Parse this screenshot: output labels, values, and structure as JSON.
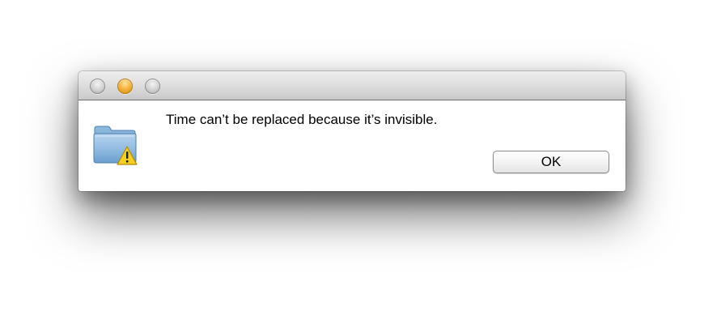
{
  "dialog": {
    "message": "Time can’t be replaced because it’s invisible.",
    "icon": "folder-warning-icon",
    "ok_label": "OK"
  },
  "window_controls": {
    "close": "close-button",
    "minimize": "minimize-button",
    "zoom": "zoom-button"
  },
  "colors": {
    "accent_orange": "#f6b23a",
    "folder_blue": "#7fb0d9",
    "warning_yellow": "#f5cf1f"
  }
}
